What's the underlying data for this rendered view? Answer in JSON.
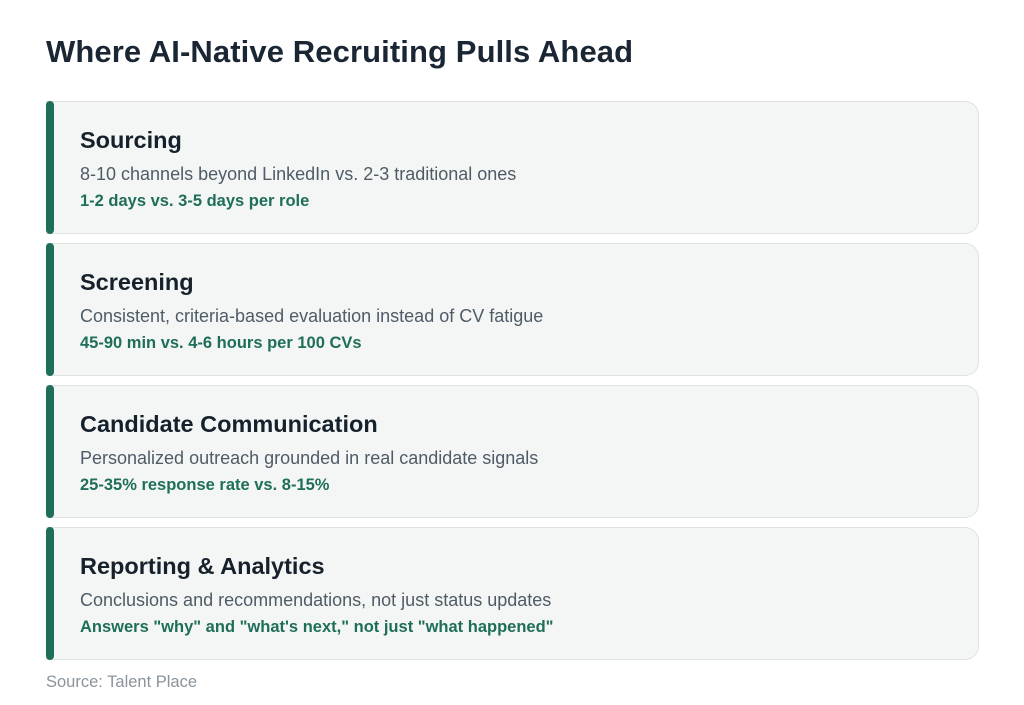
{
  "title": "Where AI-Native Recruiting Pulls Ahead",
  "accent_color": "#1f6e5a",
  "cards": [
    {
      "title": "Sourcing",
      "description": "8-10 channels beyond LinkedIn vs. 2-3 traditional ones",
      "metric": "1-2 days vs. 3-5 days per role"
    },
    {
      "title": "Screening",
      "description": "Consistent, criteria-based evaluation instead of CV fatigue",
      "metric": "45-90 min vs. 4-6 hours per 100 CVs"
    },
    {
      "title": "Candidate Communication",
      "description": "Personalized outreach grounded in real candidate signals",
      "metric": "25-35% response rate vs. 8-15%"
    },
    {
      "title": "Reporting & Analytics",
      "description": "Conclusions and recommendations, not just status updates",
      "metric": "Answers \"why\" and \"what's next,\" not just \"what happened\""
    }
  ],
  "source": "Source: Talent Place"
}
